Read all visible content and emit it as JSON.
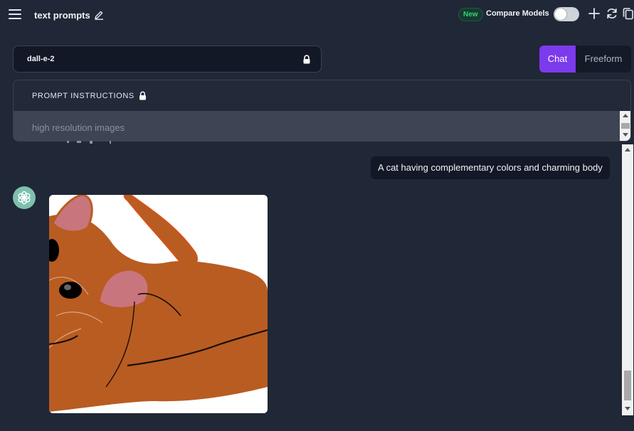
{
  "header": {
    "title": "text prompts",
    "new_badge": "New",
    "compare_label": "Compare Models",
    "compare_enabled": false
  },
  "model_select": {
    "value": "dall-e-2",
    "locked": true
  },
  "mode_switch": {
    "options": [
      "Chat",
      "Freeform"
    ],
    "selected": "Chat",
    "accent_color": "#7c3aed"
  },
  "prompt_instructions": {
    "label": "PROMPT INSTRUCTIONS",
    "placeholder": "high resolution images"
  },
  "chat": {
    "user_message": "A cat having complementary colors and charming body",
    "assistant_avatar_icon": "openai-logo-icon",
    "generated_image_subject": "stylized orange cat illustration"
  },
  "icons": {
    "menu": "hamburger-menu-icon",
    "edit_title": "pencil-icon",
    "add": "plus-icon",
    "refresh": "refresh-icon",
    "copy": "copy-icon",
    "lock": "lock-icon"
  }
}
